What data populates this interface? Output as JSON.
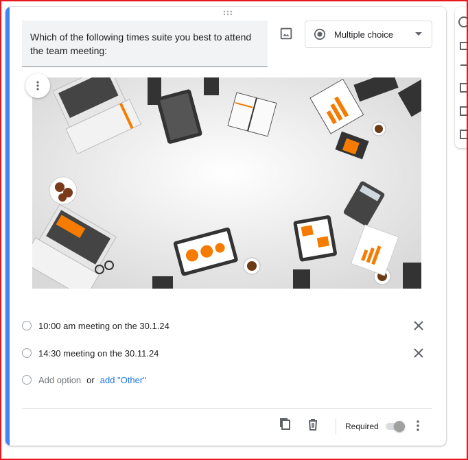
{
  "question": {
    "title": "Which of the following times suite you best to attend the team meeting:",
    "type_label": "Multiple choice"
  },
  "options": [
    {
      "label": "10:00 am meeting on the 30.1.24"
    },
    {
      "label": "14:30 meeting on the 30.11.24"
    }
  ],
  "add_option": {
    "label": "Add option",
    "or": "or",
    "other_link": "add \"Other\""
  },
  "footer": {
    "required_label": "Required"
  },
  "colors": {
    "accent": "#4285f4",
    "link": "#1a73e8",
    "frame": "#e8171c"
  },
  "icons": [
    "drag-handle-icon",
    "image-icon",
    "radio-button-icon",
    "dropdown-arrow-icon",
    "more-vert-icon",
    "close-icon",
    "copy-icon",
    "delete-icon"
  ]
}
